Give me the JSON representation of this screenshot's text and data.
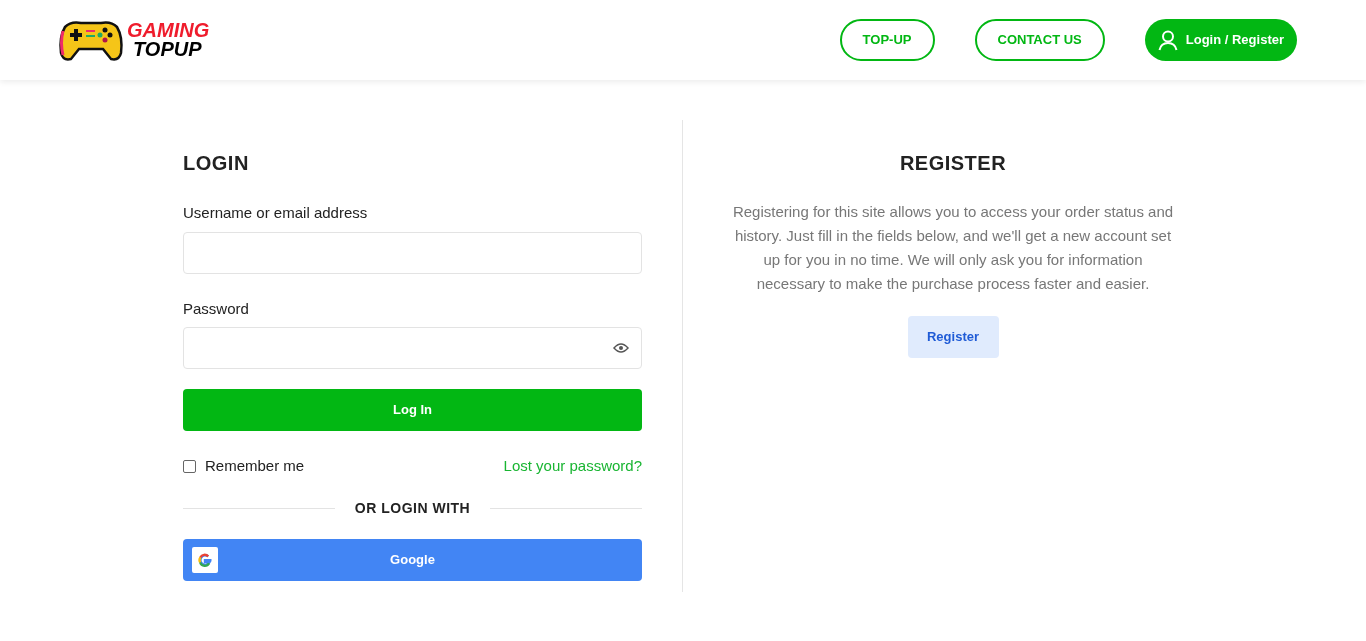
{
  "header": {
    "logo": {
      "line_1": "GAMING",
      "line_2": "TOPUP"
    },
    "nav": [
      {
        "label": "TOP-UP",
        "kind": "outline"
      },
      {
        "label": "CONTACT US",
        "kind": "outline"
      },
      {
        "label": "Login / Register",
        "kind": "account"
      }
    ]
  },
  "login": {
    "title": "LOGIN",
    "username_label": "Username or email address",
    "password_label": "Password",
    "submit": "Log In",
    "remember": {
      "label": "Remember me",
      "checked": false
    },
    "lost_password": "Lost your password?",
    "divider": "OR LOGIN WITH",
    "google": "Google"
  },
  "register": {
    "title": "REGISTER",
    "text": "Registering for this site allows you to access your order status and history. Just fill in the fields below, and we'll get a new account set up for you in no time. We will only ask you for information necessary to make the purchase process faster and easier.",
    "button": "Register"
  }
}
